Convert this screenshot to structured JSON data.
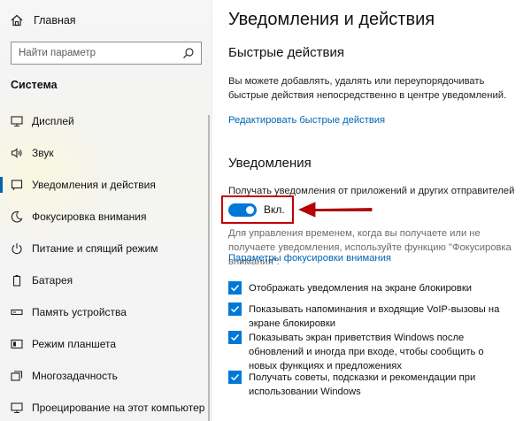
{
  "sidebar": {
    "home_label": "Главная",
    "search_placeholder": "Найти параметр",
    "section_title": "Система",
    "items": [
      {
        "label": "Дисплей",
        "icon": "display-icon"
      },
      {
        "label": "Звук",
        "icon": "sound-icon"
      },
      {
        "label": "Уведомления и действия",
        "icon": "notifications-icon",
        "active": true
      },
      {
        "label": "Фокусировка внимания",
        "icon": "focus-assist-icon"
      },
      {
        "label": "Питание и спящий режим",
        "icon": "power-icon"
      },
      {
        "label": "Батарея",
        "icon": "battery-icon"
      },
      {
        "label": "Память устройства",
        "icon": "storage-icon"
      },
      {
        "label": "Режим планшета",
        "icon": "tablet-mode-icon"
      },
      {
        "label": "Многозадачность",
        "icon": "multitasking-icon"
      },
      {
        "label": "Проецирование на этот компьютер",
        "icon": "projecting-icon"
      }
    ]
  },
  "main": {
    "title": "Уведомления и действия",
    "quick_actions": {
      "heading": "Быстрые действия",
      "description": "Вы можете добавлять, удалять или переупорядочивать быстрые действия непосредственно в центре уведомлений.",
      "edit_link": "Редактировать быстрые действия"
    },
    "notifications": {
      "heading": "Уведомления",
      "get_label": "Получать уведомления от приложений и других отправителей",
      "toggle_label": "Вкл.",
      "toggle_on": true,
      "focus_note": "Для управления временем, когда вы получаете или не получаете уведомления, используйте функцию \"Фокусировка внимания\".",
      "focus_link": "Параметры фокусировки внимания",
      "checkboxes": [
        {
          "label": "Отображать уведомления на экране блокировки",
          "checked": true
        },
        {
          "label": "Показывать напоминания и входящие VoIP-вызовы на экране блокировки",
          "checked": true
        },
        {
          "label": "Показывать экран приветствия Windows после обновлений и иногда при входе, чтобы сообщить о новых функциях и предложениях",
          "checked": true
        },
        {
          "label": "Получать советы, подсказки и рекомендации при использовании Windows",
          "checked": true
        }
      ]
    }
  },
  "colors": {
    "accent": "#0078d7",
    "link": "#0066b4",
    "highlight": "#c00000"
  }
}
